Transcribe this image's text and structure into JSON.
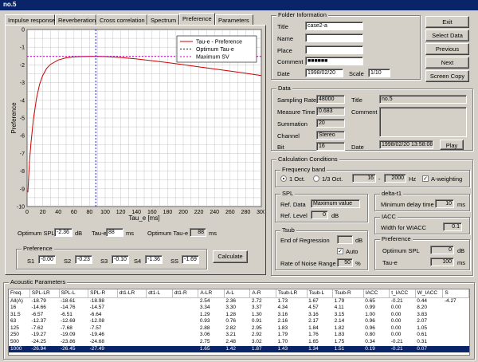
{
  "window": {
    "title": "no.5"
  },
  "tabs": [
    "Impulse response",
    "Reverberation",
    "Cross correlation",
    "Spectrum",
    "Preference",
    "Parameters"
  ],
  "chart_data": {
    "type": "line",
    "title": "",
    "xlabel": "Tau_e [ms]",
    "ylabel": "Preference",
    "xlim": [
      0,
      300
    ],
    "ylim": [
      -10,
      0
    ],
    "xticks": [
      0,
      20,
      40,
      60,
      80,
      100,
      120,
      140,
      160,
      180,
      200,
      220,
      240,
      260,
      280,
      300
    ],
    "yticks": [
      0,
      -1,
      -2,
      -3,
      -4,
      -5,
      -6,
      -7,
      -8,
      -9,
      -10
    ],
    "grid": true,
    "legend_position": "top-right",
    "series": [
      {
        "name": "Tau-e - Preference",
        "color": "#d00000",
        "style": "solid",
        "x": [
          1,
          3,
          5,
          8,
          12,
          16,
          20,
          25,
          30,
          40,
          50,
          60,
          70,
          80,
          88,
          100,
          120,
          140,
          160,
          180,
          200,
          220,
          240,
          260,
          280,
          300
        ],
        "y": [
          -9.2,
          -7.5,
          -6.4,
          -5.1,
          -3.9,
          -3.1,
          -2.6,
          -2.2,
          -1.97,
          -1.72,
          -1.6,
          -1.55,
          -1.53,
          -1.52,
          -1.52,
          -1.53,
          -1.58,
          -1.66,
          -1.76,
          -1.87,
          -1.99,
          -2.11,
          -2.23,
          -2.35,
          -2.47,
          -2.6
        ]
      },
      {
        "name": "Optimum Tau-e",
        "color": "#0000c0",
        "style": "dotted",
        "x_value": 88
      },
      {
        "name": "Maximum SV",
        "color": "#c000c0",
        "style": "dotted",
        "y_value": -1.52
      }
    ]
  },
  "preference": {
    "optimum_spl_label": "Optimum SPL",
    "optimum_spl_value": "-2.36",
    "optimum_spl_unit": "dB",
    "tau_e_label": "Tau-e",
    "tau_e_value": "88",
    "tau_e_unit": "ms",
    "optimum_tau_e_label": "Optimum Tau-e",
    "optimum_tau_e_value": "88",
    "optimum_tau_e_unit": "ms",
    "group_label": "Preference",
    "s_values": [
      {
        "label": "S1",
        "value": "-0.00"
      },
      {
        "label": "S2",
        "value": "-0.23"
      },
      {
        "label": "S3",
        "value": "-0.10"
      },
      {
        "label": "S4",
        "value": "-1.36"
      },
      {
        "label": "SS",
        "value": "-1.69"
      }
    ],
    "calculate_label": "Calculate"
  },
  "folder": {
    "group_label": "Folder Information",
    "title_label": "Title",
    "title_value": "case2-a",
    "name_label": "Name",
    "place_label": "Place",
    "comment_label": "Comment",
    "comment_value": "■■■■■■",
    "date_label": "Date",
    "date_value": "1998/02/20",
    "scale_label": "Scale",
    "scale_value": "1/10"
  },
  "buttons": {
    "exit": "Exit",
    "select_data": "Select Data",
    "previous": "Previous",
    "next": "Next",
    "screen_copy": "Screen Copy"
  },
  "data": {
    "group_label": "Data",
    "sampling_rate_label": "Sampling Rate",
    "sampling_rate_value": "48000",
    "measure_time_label": "Measure Time",
    "measure_time_value": "0.683",
    "summation_label": "Summation",
    "summation_value": "20",
    "channel_label": "Channel",
    "channel_value": "Stereo",
    "bit_label": "Bit",
    "bit_value": "16",
    "title_label": "Title",
    "title_value": "no.5",
    "comment_label": "Comment",
    "date_label": "Date",
    "date_value": "1998/02/20 13:58:08",
    "play_label": "Play"
  },
  "calc": {
    "group_label": "Calculation Conditions",
    "freq_band_label": "Frequency band",
    "oct1_label": "1 Oct.",
    "oct3_label": "1/3 Oct.",
    "freq_from": "16",
    "freq_to": "2000",
    "freq_unit": "Hz",
    "a_weighting_label": "A-weighting",
    "spl_label": "SPL",
    "ref_data_label": "Ref. Data",
    "ref_data_value": "Maximum value",
    "ref_level_label": "Ref. Level",
    "ref_level_value": "0",
    "ref_level_unit": "dB",
    "delta_t1_label": "delta-t1",
    "min_delay_label": "Minimum delay time",
    "min_delay_value": "10",
    "min_delay_unit": "ms",
    "iacc_label": "IACC",
    "width_wiacc_label": "Width for WIACC",
    "width_wiacc_value": "0.1",
    "tsub_label": "Tsub",
    "end_regression_label": "End of Regression",
    "end_regression_unit": "dB",
    "auto_label": "Auto",
    "noise_range_label": "Rate of Noise Range",
    "noise_range_value": "50",
    "noise_range_unit": "%",
    "pref_label": "Preference",
    "pref_opt_spl_label": "Optimum SPL",
    "pref_opt_spl_value": "0",
    "pref_opt_spl_unit": "dB",
    "pref_tau_e_label": "Tau-e",
    "pref_tau_e_value": "100",
    "pref_tau_e_unit": "ms"
  },
  "acoustic": {
    "group_label": "Acoustic Parameters",
    "columns": [
      "Freq.",
      "SPL-LR",
      "SPL-L",
      "SPL-R",
      "dt1-LR",
      "dt1-L",
      "dt1-R",
      "A-LR",
      "A-L",
      "A-R",
      "Tsub-LR",
      "Tsub-L",
      "Tsub-R",
      "IACC",
      "t_IACC",
      "W_IACC",
      "S"
    ],
    "selected_row": 7,
    "rows": [
      [
        "All(A)",
        "-18.79",
        "-18.61",
        "-18.98",
        "",
        "",
        "",
        "2.54",
        "2.36",
        "2.72",
        "1.73",
        "1.67",
        "1.79",
        "0.65",
        "-0.21",
        "0.44",
        "-4.27"
      ],
      [
        "16",
        "-14.66",
        "-14.76",
        "-14.57",
        "",
        "",
        "",
        "3.34",
        "3.30",
        "3.37",
        "4.34",
        "4.57",
        "4.11",
        "0.99",
        "0.00",
        "8.20",
        ""
      ],
      [
        "31.5",
        "-6.57",
        "-6.51",
        "-6.64",
        "",
        "",
        "",
        "1.29",
        "1.28",
        "1.30",
        "3.16",
        "3.16",
        "3.15",
        "1.00",
        "0.00",
        "3.83",
        ""
      ],
      [
        "63",
        "-12.37",
        "-12.69",
        "-12.08",
        "",
        "",
        "",
        "0.93",
        "0.76",
        "0.91",
        "2.16",
        "2.17",
        "2.14",
        "0.96",
        "0.00",
        "2.07",
        ""
      ],
      [
        "125",
        "-7.62",
        "-7.68",
        "-7.57",
        "",
        "",
        "",
        "2.88",
        "2.82",
        "2.95",
        "1.83",
        "1.84",
        "1.82",
        "0.96",
        "0.00",
        "1.05",
        ""
      ],
      [
        "250",
        "-19.27",
        "-19.09",
        "-19.46",
        "",
        "",
        "",
        "3.06",
        "3.21",
        "2.92",
        "1.79",
        "1.76",
        "1.83",
        "0.80",
        "0.00",
        "0.61",
        ""
      ],
      [
        "500",
        "-24.25",
        "-23.86",
        "-24.68",
        "",
        "",
        "",
        "2.75",
        "2.48",
        "3.02",
        "1.70",
        "1.65",
        "1.75",
        "0.34",
        "-0.21",
        "0.31",
        ""
      ],
      [
        "1000",
        "-26.94",
        "-26.45",
        "-27.49",
        "",
        "",
        "",
        "1.65",
        "1.42",
        "1.87",
        "1.43",
        "1.34",
        "1.51",
        "0.19",
        "-0.21",
        "0.07",
        ""
      ]
    ]
  }
}
